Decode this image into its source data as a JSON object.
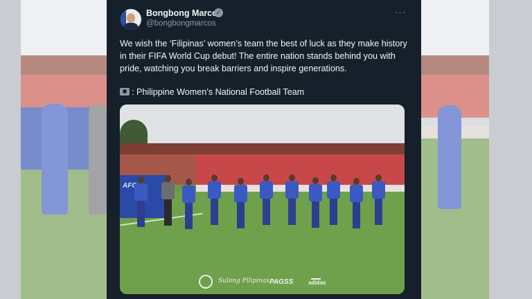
{
  "tweet": {
    "display_name": "Bongbong Marcos",
    "handle": "@bongbongmarcos",
    "verified_icon": "verified-badge-icon",
    "more_icon": "more-options-icon",
    "body": "We wish the ‘Filipinas’ women’s team the best of luck as they make history in their FIFA World Cup debut! The entire nation stands behind you with pride, watching you break barriers and inspire generations.",
    "photo_credit_icon": "camera-icon",
    "photo_credit": ": Philippine Women’s National Football Team"
  },
  "photo": {
    "board_text": "AFC",
    "logos": {
      "signature": "Sulong Pilipinas",
      "pags": "PAGSS",
      "adidas": "adidas"
    }
  },
  "colors": {
    "tweet_background": "#15202b",
    "primary_text": "#f3f5f7",
    "secondary_text": "#8b98a5",
    "jersey_blue": "#3a59c2"
  }
}
